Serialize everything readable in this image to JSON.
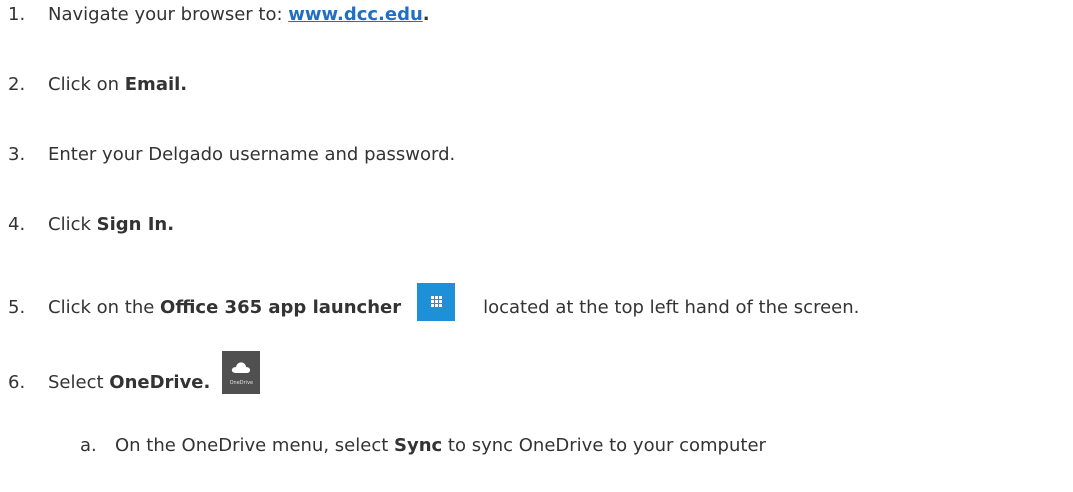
{
  "steps": [
    {
      "num": "1.",
      "text": "Navigate your browser to: ",
      "link": "www.dcc.edu",
      "after": "."
    },
    {
      "num": "2.",
      "text": "Click on ",
      "bold": "Email."
    },
    {
      "num": "3.",
      "text": "Enter your Delgado username and password."
    },
    {
      "num": "4.",
      "text": "Click ",
      "bold": "Sign In."
    },
    {
      "num": "5.",
      "text": "Click on the ",
      "bold": "Office 365 app launcher",
      "after": "located at the top left hand of the screen.",
      "icon": "app-launcher-icon"
    },
    {
      "num": "6.",
      "text": "Select ",
      "bold": "OneDrive.",
      "icon": "onedrive-tile-icon",
      "icon_label": "OneDrive"
    }
  ],
  "substeps": [
    {
      "num": "a.",
      "text": "On the OneDrive menu, select ",
      "bold": "Sync",
      "after": " to sync OneDrive to your computer"
    }
  ],
  "colors": {
    "text": "#333333",
    "link": "#1f6fc5",
    "app_launcher_tile": "#1e90d8",
    "onedrive_tile": "#505050"
  }
}
